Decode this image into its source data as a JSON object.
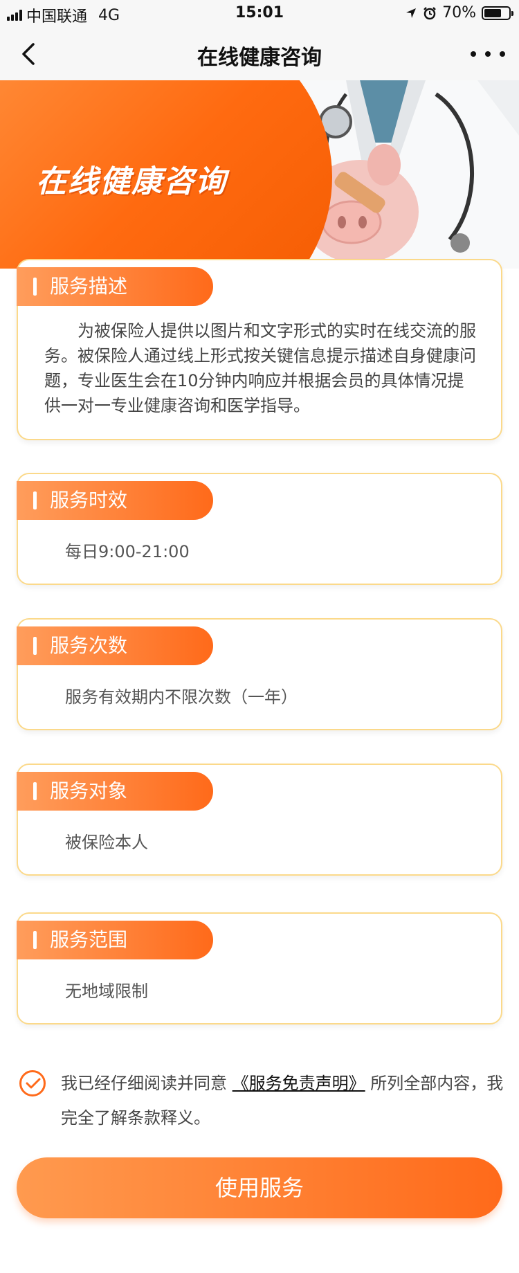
{
  "status_bar": {
    "carrier": "中国联通",
    "network": "4G",
    "time": "15:01",
    "battery": "70%",
    "battery_level": 0.7
  },
  "nav": {
    "title": "在线健康咨询"
  },
  "hero": {
    "title": "在线健康咨询"
  },
  "sections": [
    {
      "title": "服务描述",
      "content": "为被保险人提供以图片和文字形式的实时在线交流的服务。被保险人通过线上形式按关键信息提示描述自身健康问题，专业医生会在10分钟内响应并根据会员的具体情况提供一对一专业健康咨询和医学指导。"
    },
    {
      "title": "服务时效",
      "content": "每日9:00-21:00"
    },
    {
      "title": "服务次数",
      "content": "服务有效期内不限次数（一年）"
    },
    {
      "title": "服务对象",
      "content": "被保险本人"
    },
    {
      "title": "服务范围",
      "content": "无地域限制"
    }
  ],
  "agreement": {
    "prefix": "我已经仔细阅读并同意",
    "link": "《服务免责声明》",
    "suffix": "所列全部内容，我完全了解条款释义。",
    "checked": true
  },
  "button": {
    "label": "使用服务"
  },
  "colors": {
    "accent": "#ff6a1a",
    "card_border": "#fbd98a"
  }
}
